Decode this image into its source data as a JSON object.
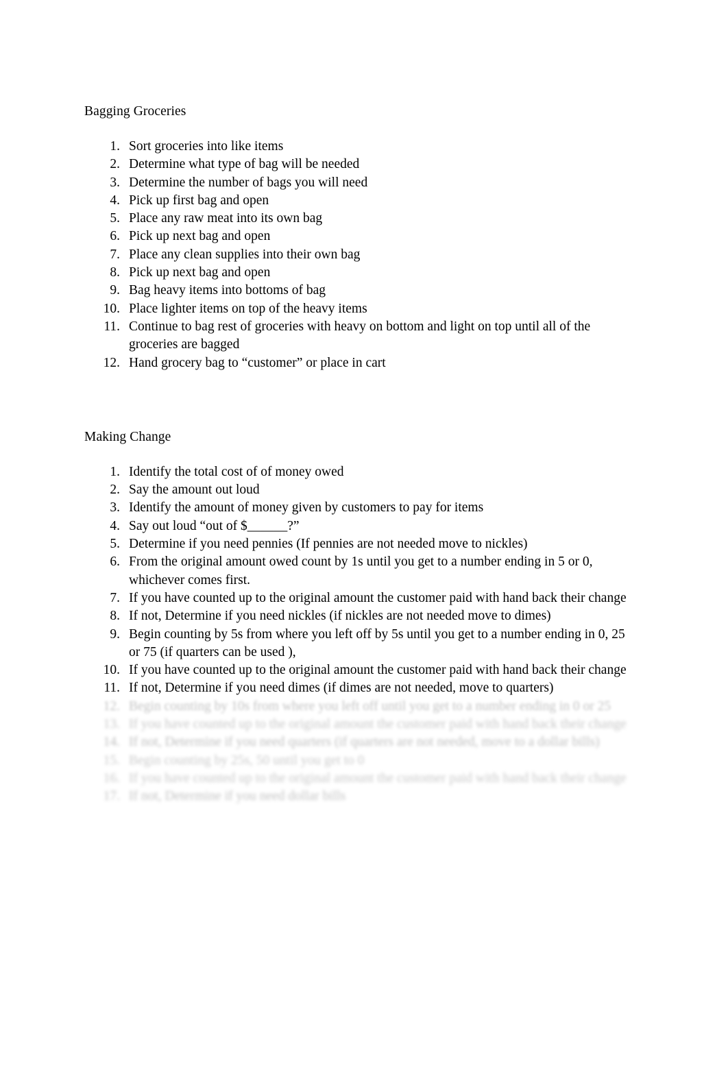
{
  "document": {
    "background_color": "#ffffff",
    "text_color": "#000000",
    "faded_text_color": "#c2c2c2"
  },
  "sections": [
    {
      "heading": "Bagging Groceries",
      "steps": [
        {
          "number": "1.",
          "text": "Sort groceries into like items"
        },
        {
          "number": "2.",
          "text": "Determine what type of bag will be needed"
        },
        {
          "number": "3.",
          "text": "Determine the number of bags you will need"
        },
        {
          "number": "4.",
          "text": "Pick up first bag and open"
        },
        {
          "number": "5.",
          "text": "Place any raw meat into its own bag"
        },
        {
          "number": "6.",
          "text": "Pick up next bag and open"
        },
        {
          "number": "7.",
          "text": "Place any clean supplies into their own bag"
        },
        {
          "number": "8.",
          "text": "Pick up next bag and open"
        },
        {
          "number": "9.",
          "text": "Bag heavy items into bottoms of bag"
        },
        {
          "number": "10.",
          "text": "Place lighter items on top of the heavy items"
        },
        {
          "number": "11.",
          "text": "Continue to bag rest of groceries with heavy on bottom and light on top until all of the groceries are bagged"
        },
        {
          "number": "12.",
          "text": "Hand grocery bag to “customer” or place in cart"
        }
      ]
    },
    {
      "heading": "Making Change",
      "steps": [
        {
          "number": "1.",
          "text": "Identify the total cost of of money owed"
        },
        {
          "number": "2.",
          "text": "Say the amount out loud"
        },
        {
          "number": "3.",
          "text": "Identify the amount of money given by customers to pay for items"
        },
        {
          "number": "4.",
          "text": "Say out loud “out of $______?”"
        },
        {
          "number": "5.",
          "text": "Determine if you need pennies (If pennies are not needed move to nickles)"
        },
        {
          "number": "6.",
          "text": "From the original amount owed count by 1s until you get to a number ending in 5 or 0, whichever comes first."
        },
        {
          "number": "7.",
          "text": "If you have counted up to the original amount the customer paid with hand back their change"
        },
        {
          "number": "8.",
          "text": "If not, Determine if you need nickles (if nickles are not needed move to dimes)"
        },
        {
          "number": "9.",
          "text": "Begin counting by 5s from where you left off by 5s until you get to a number ending in 0, 25 or 75 (if quarters can be used ),"
        },
        {
          "number": "10.",
          "text": "If you have counted up to the original amount the customer paid with hand back their change"
        },
        {
          "number": "11.",
          "text": "If not, Determine if you need dimes (if dimes are not needed, move to quarters)"
        }
      ],
      "faded_steps": [
        {
          "number": "12.",
          "text": "Begin counting by 10s from where you left off until you get to a number ending in 0 or 25"
        },
        {
          "number": "13.",
          "text": "If you have counted up to the original amount the customer paid with hand back their change"
        },
        {
          "number": "14.",
          "text": "If not, Determine if you need quarters (if quarters are not needed, move to a dollar bills)"
        },
        {
          "number": "15.",
          "text": "Begin counting by 25s, 50 until you get to 0"
        },
        {
          "number": "16.",
          "text": "If you have counted up to the original amount the customer paid with hand back their change"
        },
        {
          "number": "17.",
          "text": "If not, Determine if you need dollar bills"
        }
      ]
    }
  ]
}
